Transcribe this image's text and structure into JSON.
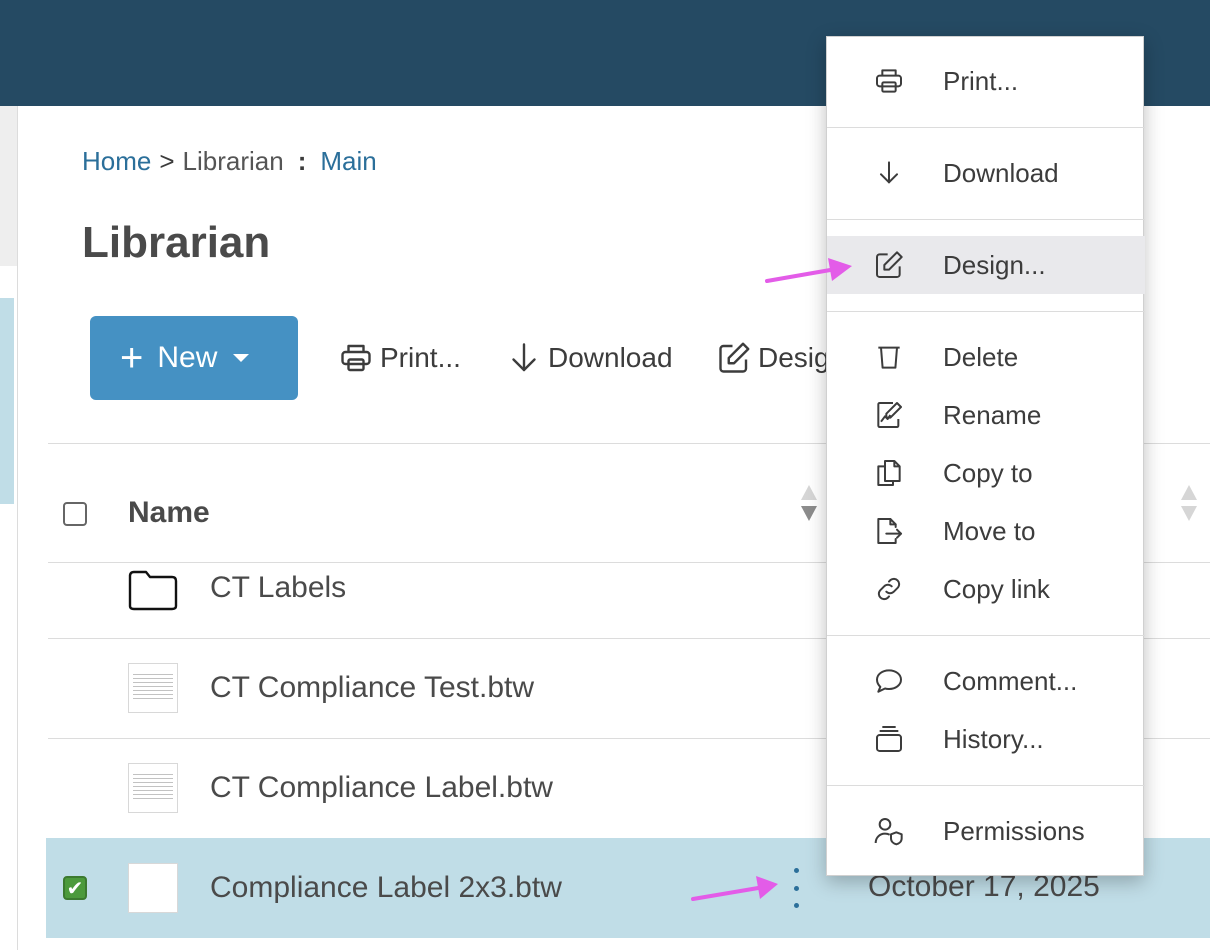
{
  "breadcrumb": {
    "home": "Home",
    "separator": ">",
    "current": "Librarian",
    "colon": ":",
    "branch": "Main"
  },
  "page": {
    "title": "Librarian"
  },
  "toolbar": {
    "new_plus": "+",
    "new_label": "New",
    "print_label": "Print...",
    "download_label": "Download",
    "design_label": "Desig"
  },
  "table": {
    "column_name": "Name",
    "rows": [
      {
        "name": "CT Labels",
        "icon": "folder-icon"
      },
      {
        "name": "CT Compliance Test.btw",
        "icon": "label-thumbnail"
      },
      {
        "name": "CT Compliance Label.btw",
        "icon": "label-thumbnail"
      },
      {
        "name": "Compliance Label 2x3.btw",
        "icon": "label-thumbnail",
        "selected": true,
        "date": "October 17, 2025"
      }
    ],
    "selected_check": "✔"
  },
  "context_menu": {
    "items": [
      {
        "label": "Print...",
        "icon": "printer-icon"
      },
      {
        "label": "Download",
        "icon": "download-arrow-icon"
      },
      {
        "label": "Design...",
        "icon": "pencil-square-icon",
        "highlighted": true
      },
      {
        "label": "Delete",
        "icon": "trash-icon"
      },
      {
        "label": "Rename",
        "icon": "rename-icon"
      },
      {
        "label": "Copy to",
        "icon": "copy-icon"
      },
      {
        "label": "Move to",
        "icon": "move-icon"
      },
      {
        "label": "Copy link",
        "icon": "link-icon"
      },
      {
        "label": "Comment...",
        "icon": "speech-bubble-icon"
      },
      {
        "label": "History...",
        "icon": "history-stack-icon"
      },
      {
        "label": "Permissions",
        "icon": "user-shield-icon"
      }
    ]
  },
  "colors": {
    "topbar": "#254a63",
    "accent": "#4591c3",
    "link": "#2b6f9a",
    "selected_row": "#c0dde7",
    "annotation_arrow": "#e35ce8"
  }
}
